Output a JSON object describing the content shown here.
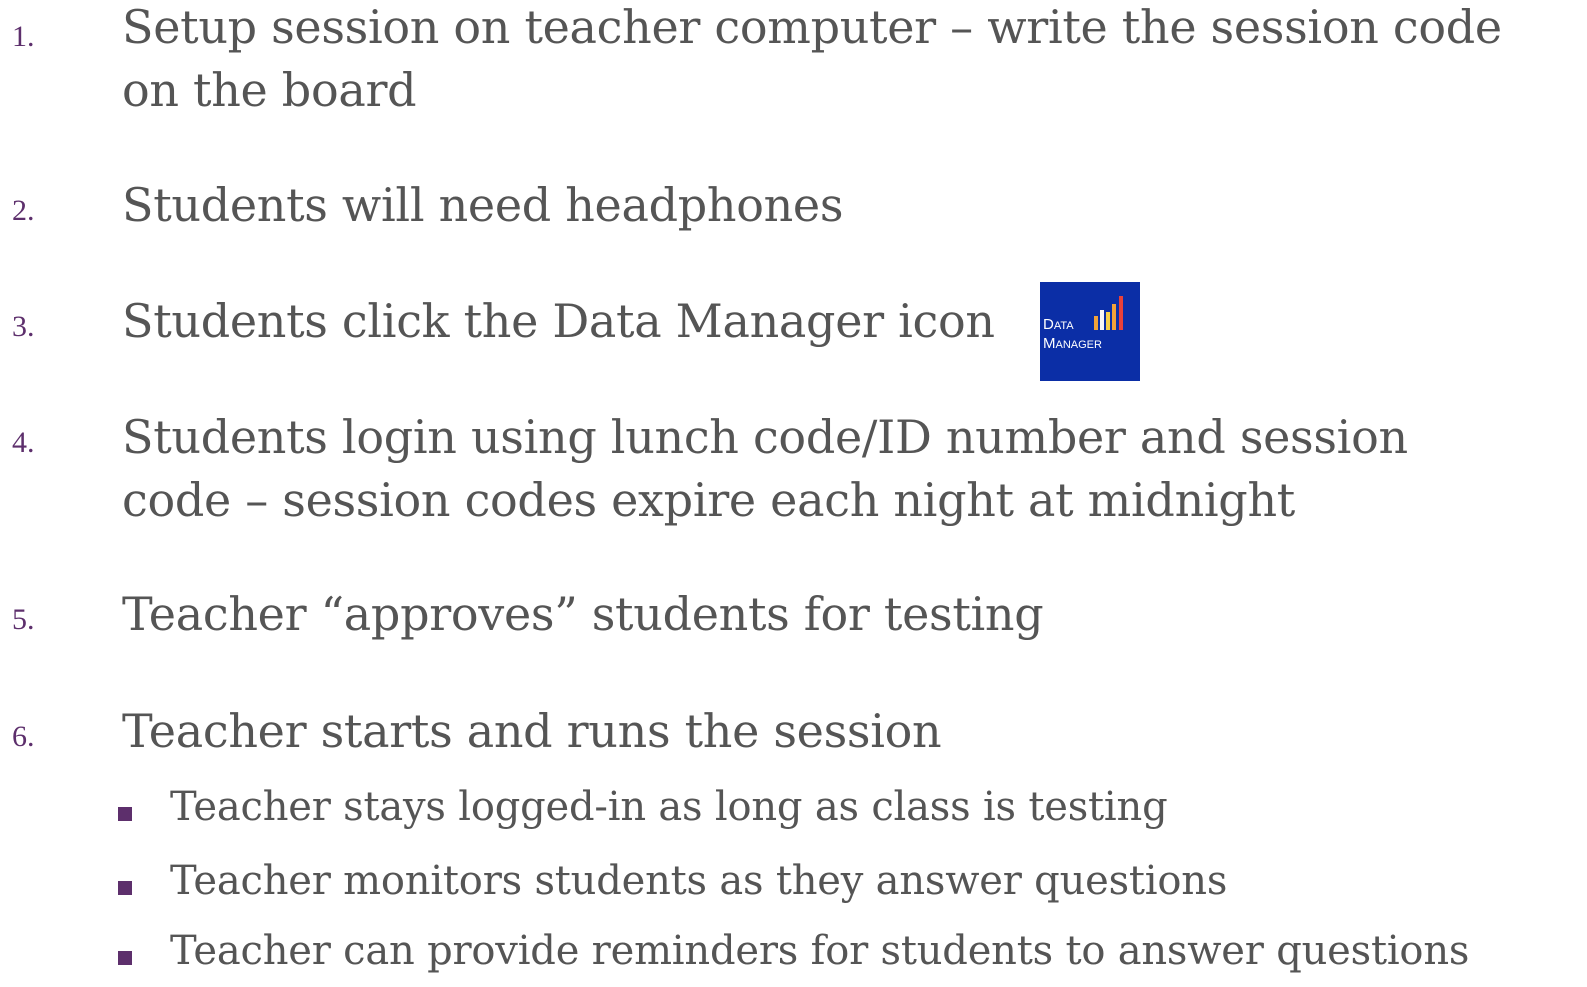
{
  "steps": [
    {
      "number": "1.",
      "lines": [
        "Setup session on teacher computer – write the session code",
        "on the board"
      ]
    },
    {
      "number": "2.",
      "lines": [
        "Students will need headphones"
      ]
    },
    {
      "number": "3.",
      "lines": [
        "Students click the Data Manager icon"
      ]
    },
    {
      "number": "4.",
      "lines": [
        "Students login using lunch code/ID number and session",
        "code – session codes expire each night at midnight"
      ]
    },
    {
      "number": "5.",
      "lines": [
        "Teacher “approves” students for testing"
      ]
    },
    {
      "number": "6.",
      "lines": [
        "Teacher starts and runs the session"
      ]
    }
  ],
  "sub_bullets": [
    "Teacher stays logged-in as long as class is testing",
    "Teacher monitors students as they answer questions",
    "Teacher can provide reminders for students to answer questions"
  ],
  "data_manager_logo": {
    "icon": "data-manager-logo-icon",
    "line1": "Data",
    "line2": "Manager",
    "background": "#0b2ea6",
    "bar_colors": [
      "#f2a23a",
      "#f5d04a",
      "#e8413a",
      "#f7f7f7"
    ]
  },
  "colors": {
    "text": "#555555",
    "accent": "#5d2f6c"
  }
}
